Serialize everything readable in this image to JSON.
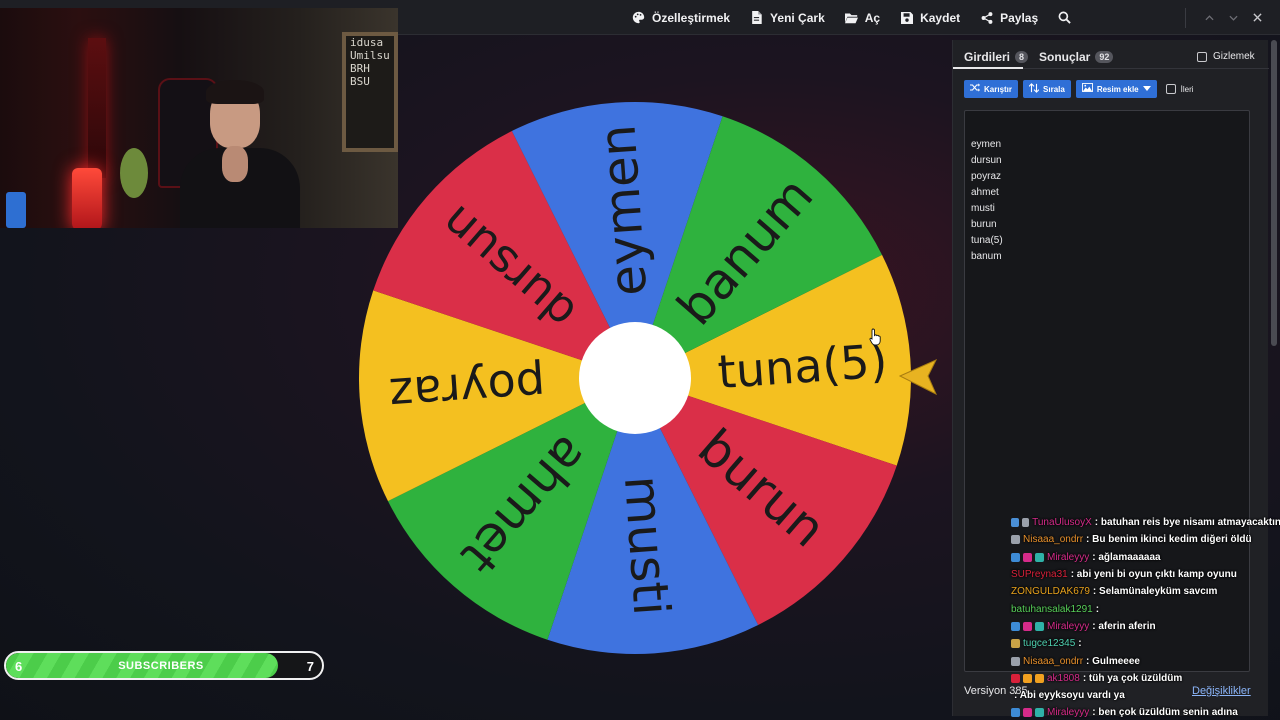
{
  "toolbar": {
    "items": [
      {
        "label": "Özelleştirmek",
        "icon": "palette-icon"
      },
      {
        "label": "Yeni Çark",
        "icon": "file-icon"
      },
      {
        "label": "Aç",
        "icon": "folder-icon"
      },
      {
        "label": "Kaydet",
        "icon": "save-icon"
      },
      {
        "label": "Paylaş",
        "icon": "share-icon"
      }
    ],
    "window_controls": [
      "chevron-up-icon",
      "chevron-down-icon",
      "close-icon"
    ]
  },
  "webcam": {
    "board_lines": [
      "idusa",
      "Umilsu",
      "BRH",
      "BSU"
    ]
  },
  "wheel": {
    "segments": [
      {
        "label": "tuna(5)",
        "color": "#f4c020"
      },
      {
        "label": "burun",
        "color": "#da2f48"
      },
      {
        "label": "musti",
        "color": "#3f73df"
      },
      {
        "label": "ahmet",
        "color": "#2fb23e"
      },
      {
        "label": "poyraz",
        "color": "#f4c020"
      },
      {
        "label": "dursun",
        "color": "#da2f48"
      },
      {
        "label": "eymen",
        "color": "#3f73df"
      },
      {
        "label": "banum",
        "color": "#2fb23e"
      }
    ],
    "pointer_color": "#e8b321"
  },
  "subscribers": {
    "current": "6",
    "goal": "7",
    "label": "SUBSCRIBERS",
    "progress": 0.86
  },
  "panel": {
    "tabs": [
      {
        "label": "Girdileri",
        "count": "8"
      },
      {
        "label": "Sonuçlar",
        "count": "92"
      }
    ],
    "hide_label": "Gizlemek",
    "buttons": {
      "shuffle": "Karıştır",
      "sort": "Sırala",
      "add_image": "Resim ekle",
      "advanced": "İleri"
    },
    "entries": [
      "eymen",
      "dursun",
      "poyraz",
      "ahmet",
      "musti",
      "burun",
      "tuna(5)",
      "banum"
    ],
    "version": "Versiyon 385",
    "changes": "Değişiklikler"
  },
  "chat": [
    {
      "user": "TunaUlusoyX",
      "color": "#d62b8a",
      "message": ": batuhan reis bye nisamı atmayacaktın",
      "badges": [
        "#4a8fd6",
        "#9aa0aa"
      ]
    },
    {
      "user": "Nisaaa_ondrr",
      "color": "#e8902c",
      "message": ": Bu benim ikinci kedim diğeri öldü",
      "badges": [
        "#9aa0aa"
      ]
    },
    {
      "user": "Miraleyyy",
      "color": "#d62b8a",
      "message": ": ağlamaaaaaa",
      "badges": [
        "#3d8bd6",
        "#d62b8a",
        "#2fb2a8"
      ]
    },
    {
      "user": "SUPreyna31",
      "color": "#d8213a",
      "message": ": abi yeni bi oyun çıktı kamp oyunu",
      "badges": []
    },
    {
      "user": "ZONGULDAK679",
      "color": "#e8a21c",
      "message": ": Selamünaleyküm savcım",
      "badges": []
    },
    {
      "user": "batuhansalak1291",
      "color": "#58d05a",
      "message": ": ",
      "badges": []
    },
    {
      "user": "Miraleyyy",
      "color": "#d62b8a",
      "message": ": aferin aferin",
      "badges": [
        "#3d8bd6",
        "#d62b8a",
        "#2fb2a8"
      ]
    },
    {
      "user": "tugce12345",
      "color": "#4fd0b0",
      "message": ": ",
      "badges": [
        "#c9a246"
      ]
    },
    {
      "user": "Nisaaa_ondrr",
      "color": "#e8902c",
      "message": ": Gulmeeee",
      "badges": [
        "#9aa0aa"
      ]
    },
    {
      "user": "ak1808",
      "color": "#d62b8a",
      "message": ": tüh ya çok üzüldüm",
      "badges": [
        "#d8213a",
        "#f0a020",
        "#f0a020"
      ]
    },
    {
      "user": "",
      "color": "#8ab4f8",
      "message": ": Abi eyyksoyu vardı ya",
      "badges": []
    },
    {
      "user": "Miraleyyy",
      "color": "#d62b8a",
      "message": ": ben çok üzüldüm senin adına",
      "badges": [
        "#3d8bd6",
        "#d62b8a",
        "#2fb2a8"
      ]
    }
  ]
}
